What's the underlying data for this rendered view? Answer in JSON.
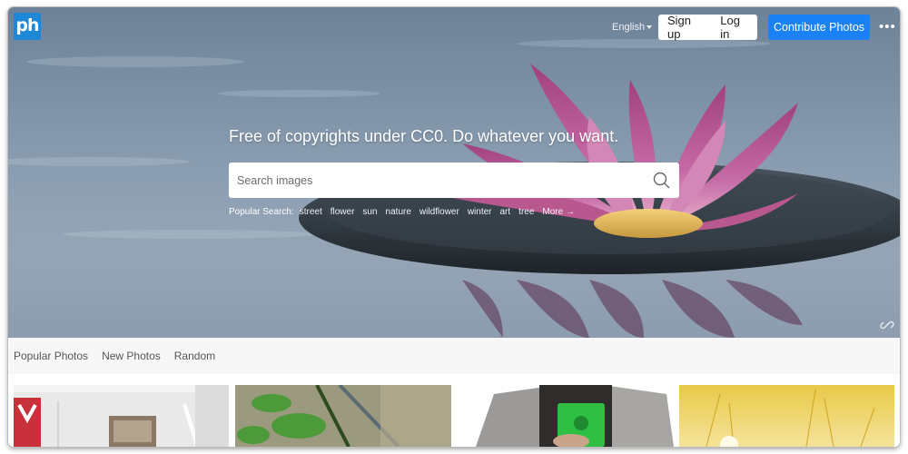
{
  "header": {
    "logo_text": "ph",
    "language": "English",
    "signup_label": "Sign up",
    "login_label": "Log in",
    "contribute_label": "Contribute Photos",
    "more_glyph": "•••",
    "accent_color": "#1a82f5"
  },
  "hero": {
    "tagline": "Free of copyrights under CC0. Do whatever you want.",
    "search": {
      "placeholder": "Search images",
      "value": ""
    },
    "popular_label": "Popular Search:",
    "popular_tags": [
      "street",
      "flower",
      "sun",
      "nature",
      "wildflower",
      "winter",
      "art",
      "tree"
    ],
    "more_label": "More →"
  },
  "tabs": [
    "Popular Photos",
    "New Photos",
    "Random"
  ],
  "icons": {
    "search": "magnifier-icon",
    "link": "link-icon",
    "more": "more-dots-icon"
  }
}
